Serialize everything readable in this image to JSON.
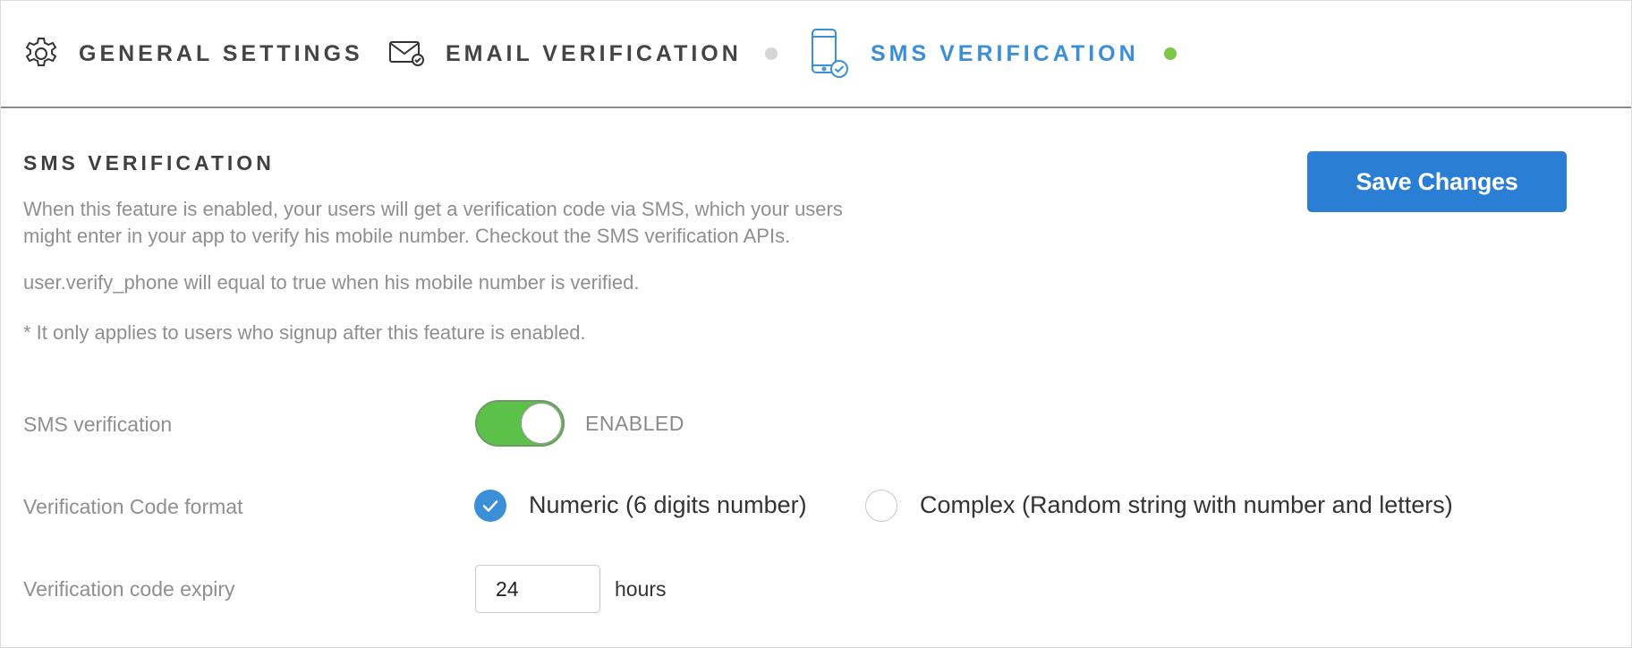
{
  "tabs": [
    {
      "label": "GENERAL SETTINGS",
      "icon": "gear-icon"
    },
    {
      "label": "EMAIL VERIFICATION",
      "icon": "envelope-check-icon",
      "status_color": "#d6d6d6"
    },
    {
      "label": "SMS VERIFICATION",
      "icon": "phone-check-icon",
      "status_color": "#7dc847",
      "active": true
    }
  ],
  "section": {
    "title": "SMS VERIFICATION",
    "description_line1": "When this feature is enabled, your users will get a verification code via SMS, which your users",
    "description_line2": "might enter in your app to verify his mobile number. Checkout the SMS verification APIs.",
    "note_verify": "user.verify_phone will equal to true when his mobile number is verified.",
    "note_signup": "* It only applies to users who signup after this feature is enabled."
  },
  "save_button": "Save Changes",
  "settings": {
    "sms_verification": {
      "label": "SMS verification",
      "enabled": true,
      "state_text": "ENABLED"
    },
    "code_format": {
      "label": "Verification Code format",
      "options": [
        {
          "label": "Numeric (6 digits number)",
          "checked": true
        },
        {
          "label": "Complex (Random string with number and letters)",
          "checked": false
        }
      ]
    },
    "expiry": {
      "label": "Verification code expiry",
      "value": "24",
      "unit": "hours"
    }
  },
  "colors": {
    "accent": "#3b8ed8",
    "button": "#2a7fd5",
    "toggle_on": "#5cc148",
    "status_active": "#7dc847",
    "status_inactive": "#d6d6d6"
  }
}
